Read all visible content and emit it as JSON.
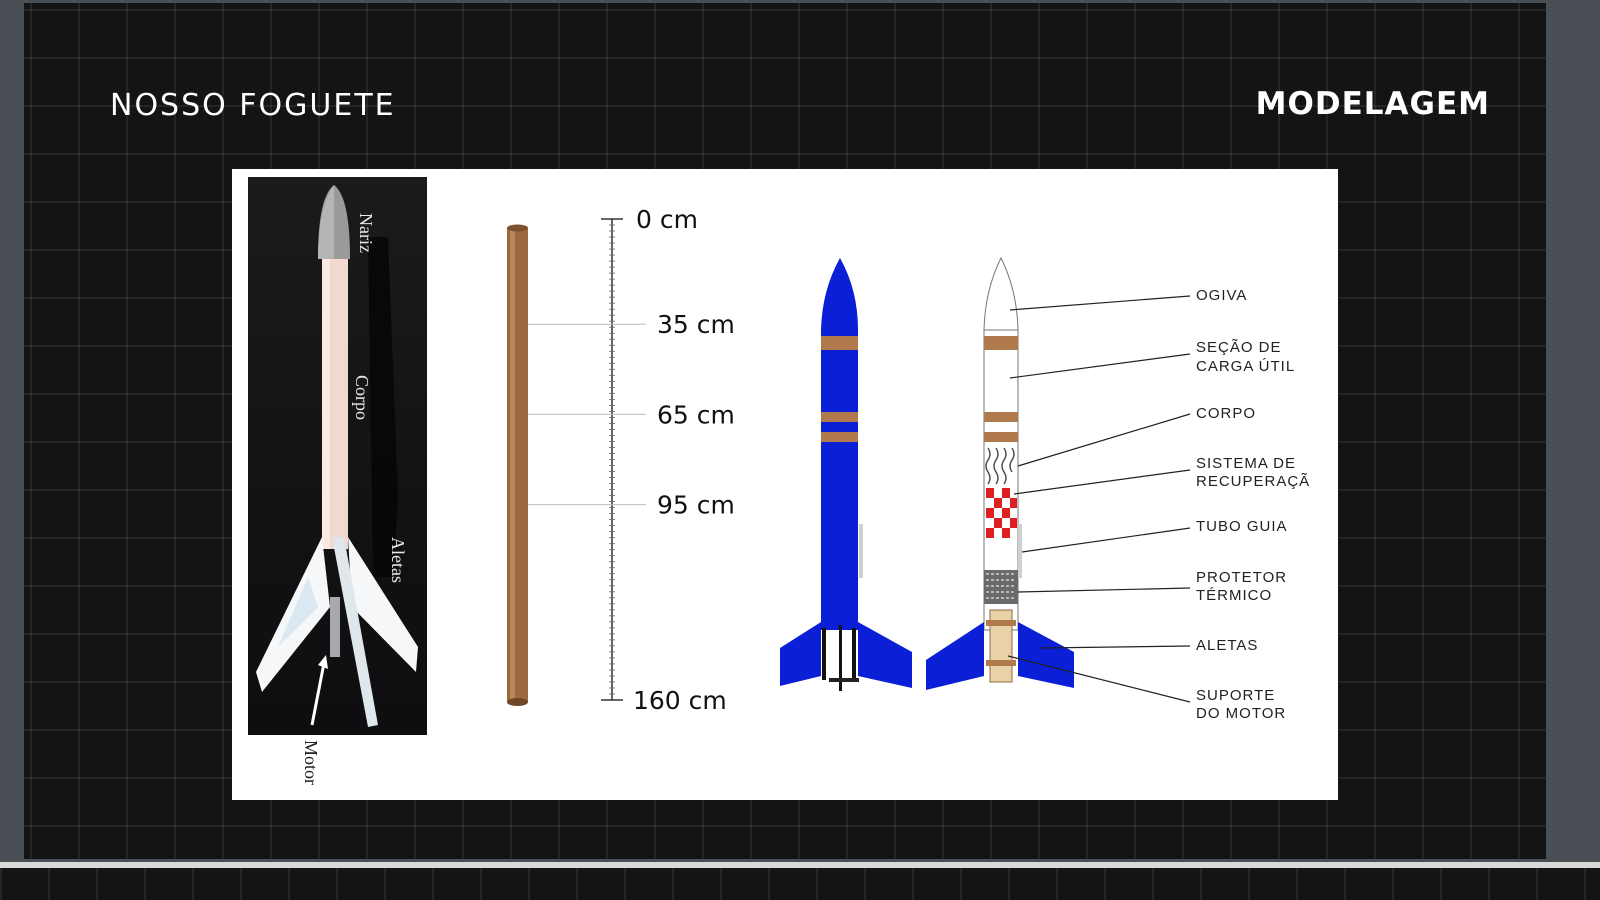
{
  "header": {
    "title_left": "NOSSO FOGUETE",
    "title_right": "MODELAGEM"
  },
  "photo_labels": {
    "nose": "Nariz",
    "body": "Corpo",
    "fins": "Aletas",
    "motor": "Motor"
  },
  "ruler": {
    "marks": [
      {
        "value": 0,
        "label": "0 cm"
      },
      {
        "value": 35,
        "label": "35 cm"
      },
      {
        "value": 65,
        "label": "65 cm"
      },
      {
        "value": 95,
        "label": "95 cm"
      },
      {
        "value": 160,
        "label": "160 cm"
      }
    ]
  },
  "diagram_labels": {
    "ogiva": "OGIVA",
    "payload_1": "SEÇÃO DE",
    "payload_2": "CARGA ÚTIL",
    "corpo": "CORPO",
    "recovery_1": "SISTEMA DE",
    "recovery_2": "RECUPERAÇÃ",
    "tubo": "TUBO GUIA",
    "thermal_1": "PROTETOR",
    "thermal_2": "TÉRMICO",
    "aletas": "ALETAS",
    "motor_1": "SUPORTE",
    "motor_2": "DO MOTOR"
  },
  "colors": {
    "rocket_blue": "#0a1fd6",
    "band_brown": "#b07a4c",
    "tube_brown": "#9c6a3e",
    "recovery_red": "#e02020",
    "background": "#141414"
  }
}
